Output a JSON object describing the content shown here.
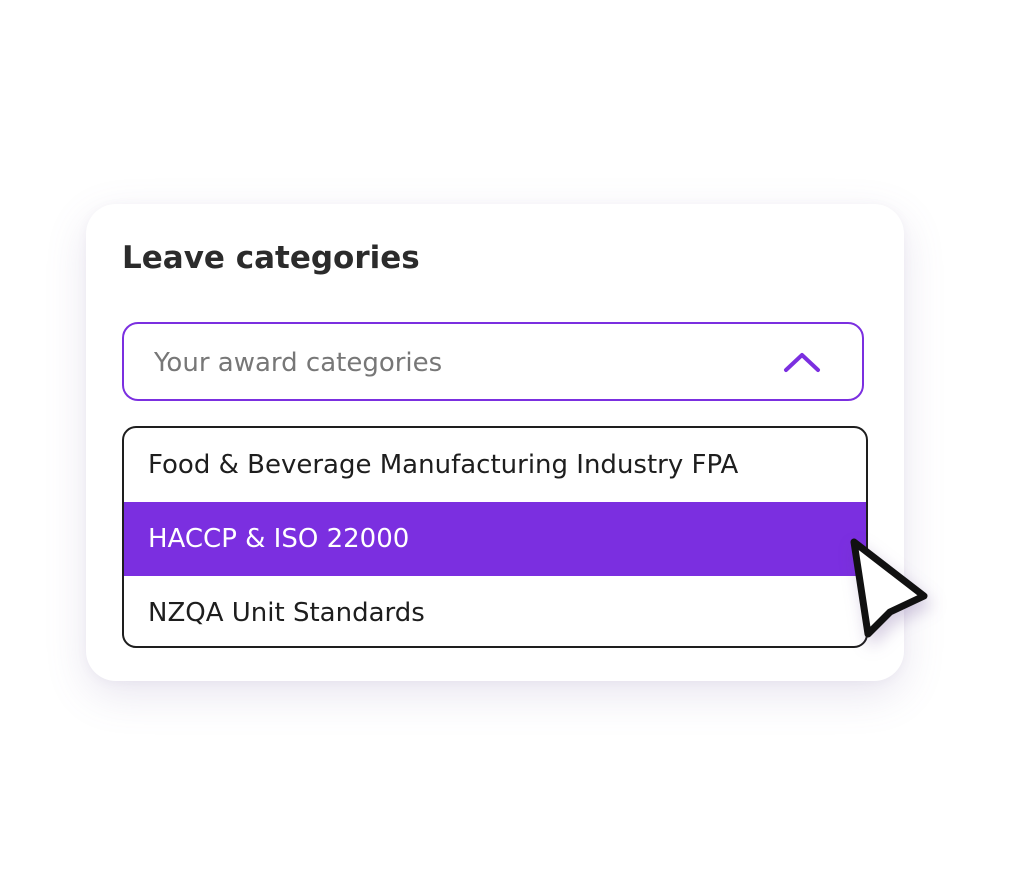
{
  "card": {
    "title": "Leave categories"
  },
  "select": {
    "placeholder": "Your award categories",
    "state": "open",
    "toggle_icon": "chevron-up-icon"
  },
  "options": [
    {
      "label": "Food & Beverage Manufacturing Industry FPA",
      "selected": false
    },
    {
      "label": "HACCP & ISO 22000",
      "selected": true
    },
    {
      "label": "NZQA Unit Standards",
      "selected": false
    }
  ],
  "pointer_icon": "mouse-pointer-icon",
  "colors": {
    "accent": "#7b2fe0",
    "title_text": "#2b2b2b",
    "placeholder_text": "#777777",
    "option_text": "#1e1e1e",
    "selected_text": "#ffffff",
    "card_background": "#ffffff"
  }
}
